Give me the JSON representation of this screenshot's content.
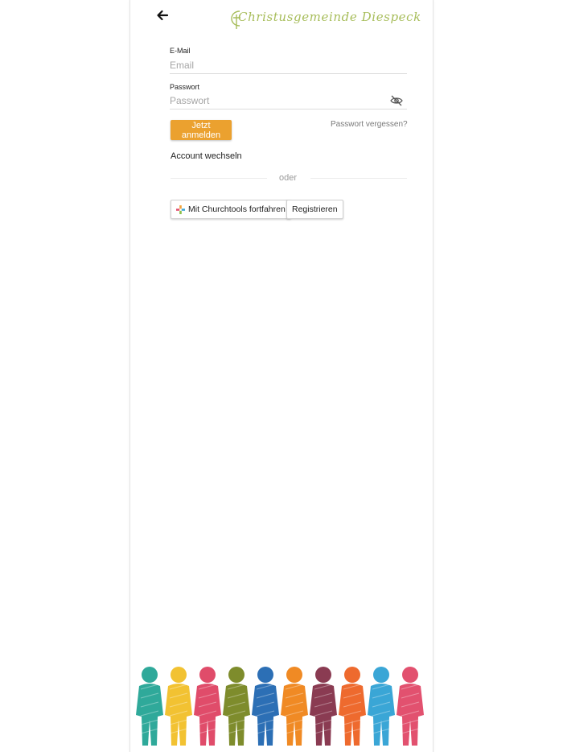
{
  "header": {
    "back_icon": "arrow-left-icon",
    "logo_text": "Christusgemeinde Diespeck"
  },
  "login": {
    "email_label": "E-Mail",
    "email_placeholder": "Email",
    "email_value": "",
    "password_label": "Passwort",
    "password_placeholder": "Passwort",
    "password_value": "",
    "toggle_icon": "eye-off-icon",
    "submit_label": "Jetzt anmelden",
    "forgot_label": "Passwort vergessen?",
    "switch_account_label": "Account wechseln",
    "divider_label": "oder",
    "churchtools_label": "Mit Churchtools fortfahren",
    "churchtools_icon": "churchtools-icon",
    "register_label": "Registrieren"
  },
  "colors": {
    "accent": "#eba12f",
    "logo": "#a7bd5a",
    "people": [
      "#2fa99a",
      "#f2c232",
      "#e04c6a",
      "#7e8c2c",
      "#2c6fb5",
      "#f08a24",
      "#8a3b52",
      "#ee6a2e",
      "#3aa6d6",
      "#e2516f"
    ]
  },
  "footer": {
    "illustration": "people-holding-hands-illustration"
  }
}
